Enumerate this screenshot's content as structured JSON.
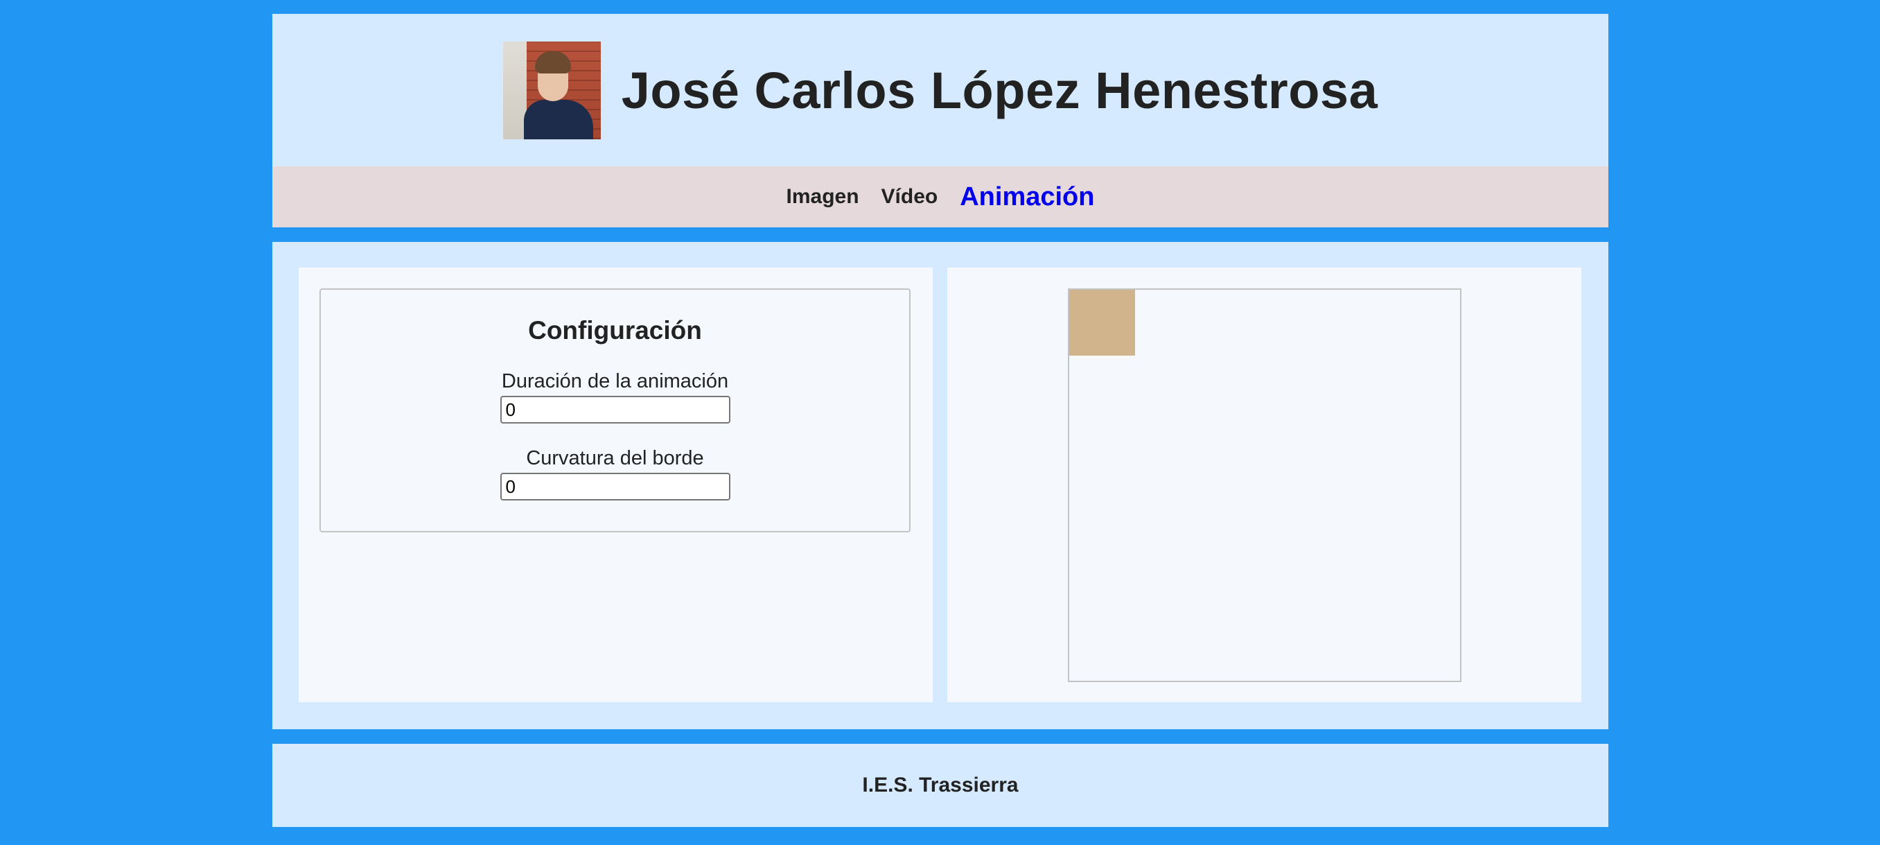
{
  "header": {
    "title": "José Carlos López Henestrosa",
    "avatar_icon": "profile-photo"
  },
  "nav": {
    "items": [
      {
        "label": "Imagen"
      },
      {
        "label": "Vídeo"
      },
      {
        "label": "Animación",
        "active": true
      }
    ],
    "active_color": "#0000ee"
  },
  "config": {
    "title": "Configuración",
    "duration_label": "Duración de la animación",
    "duration_value": "0",
    "border_label": "Curvatura del borde",
    "border_value": "0"
  },
  "stage": {
    "square_color": "#d2b48c"
  },
  "footer": {
    "text": "I.E.S. Trassierra"
  },
  "colors": {
    "background": "#2196f3",
    "section": "#d6eaff",
    "nav_background": "#e6d9dc",
    "panel": "#f5f9fd"
  }
}
